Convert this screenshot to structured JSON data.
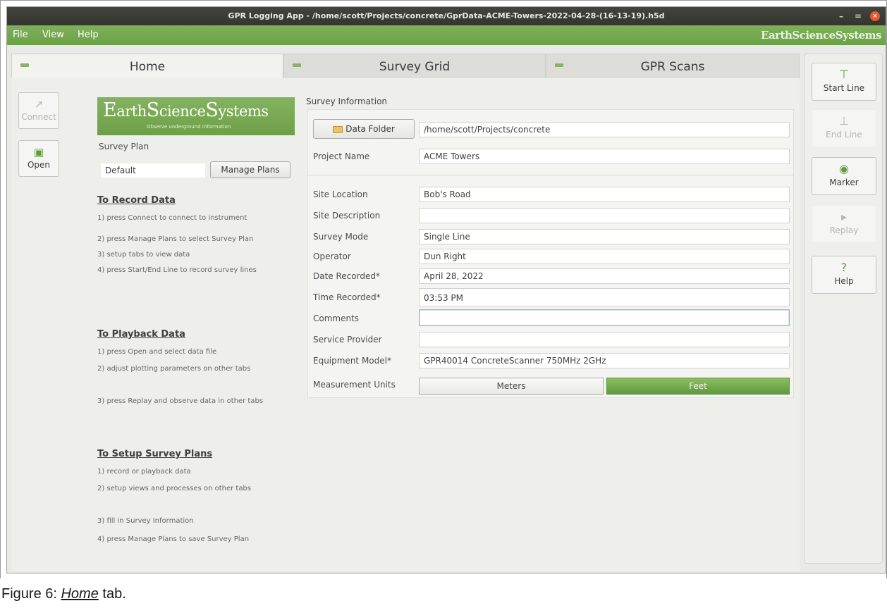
{
  "window": {
    "title": "GPR Logging App - /home/scott/Projects/concrete/GprData-ACME-Towers-2022-04-28-(16-13-19).h5d",
    "controls": [
      "–",
      "=",
      "×"
    ]
  },
  "menu": {
    "items": [
      "File",
      "View",
      "Help"
    ],
    "logo": "EarthScienceSystems"
  },
  "tabs": [
    "Home",
    "Survey Grid",
    "GPR Scans"
  ],
  "left_toolbar": {
    "connect": "Connect",
    "open": "Open"
  },
  "home": {
    "logo": {
      "parts": [
        "E",
        "arth",
        "S",
        "cience",
        "S",
        "ystems"
      ],
      "tagline": "Observe underground information"
    },
    "survey_plan_label": "Survey Plan",
    "survey_plan_value": "Default",
    "manage_plans": "Manage Plans",
    "instructions": [
      {
        "heading": "To Record Data",
        "steps": [
          "1) press Connect to connect to instrument",
          "2) press Manage Plans to select Survey Plan",
          "3) setup tabs to view data",
          "4) press Start/End Line to record survey lines"
        ]
      },
      {
        "heading": "To Playback Data",
        "steps": [
          "1) press Open and select data file",
          "2) adjust plotting parameters on other tabs",
          "3) press Replay and observe data in other tabs"
        ]
      },
      {
        "heading": "To Setup Survey Plans",
        "steps": [
          "1) record or playback data",
          "2) setup views and processes on other tabs",
          "3) fill in Survey Information",
          "4) press Manage Plans to save Survey Plan"
        ]
      }
    ]
  },
  "survey_info": {
    "title": "Survey Information",
    "data_folder_button": "Data Folder",
    "data_folder": "/home/scott/Projects/concrete",
    "project_name_label": "Project Name",
    "project_name": "ACME Towers",
    "fields": [
      {
        "label": "Site Location",
        "value": "Bob's Road"
      },
      {
        "label": "Site Description",
        "value": ""
      },
      {
        "label": "Survey Mode",
        "value": "Single Line"
      },
      {
        "label": "Operator",
        "value": "Dun Right"
      },
      {
        "label": "Date Recorded*",
        "value": "April 28, 2022"
      },
      {
        "label": "Time Recorded*",
        "value": "03:53 PM"
      },
      {
        "label": "Comments",
        "value": ""
      },
      {
        "label": "Service Provider",
        "value": ""
      },
      {
        "label": "Equipment Model*",
        "value": "GPR40014 ConcreteScanner 750MHz 2GHz"
      }
    ],
    "units_label": "Measurement Units",
    "units": [
      "Meters",
      "Feet"
    ],
    "units_selected": "Feet"
  },
  "right_toolbar": {
    "start_line": "Start Line",
    "end_line": "End Line",
    "marker": "Marker",
    "replay": "Replay",
    "help": "Help"
  },
  "caption": {
    "prefix": "Figure 6: ",
    "emphasis": "Home",
    "suffix": " tab."
  },
  "colors": {
    "accent_green": "#6aa147",
    "titlebar": "#3c3c37",
    "close_button": "#e6582a"
  }
}
